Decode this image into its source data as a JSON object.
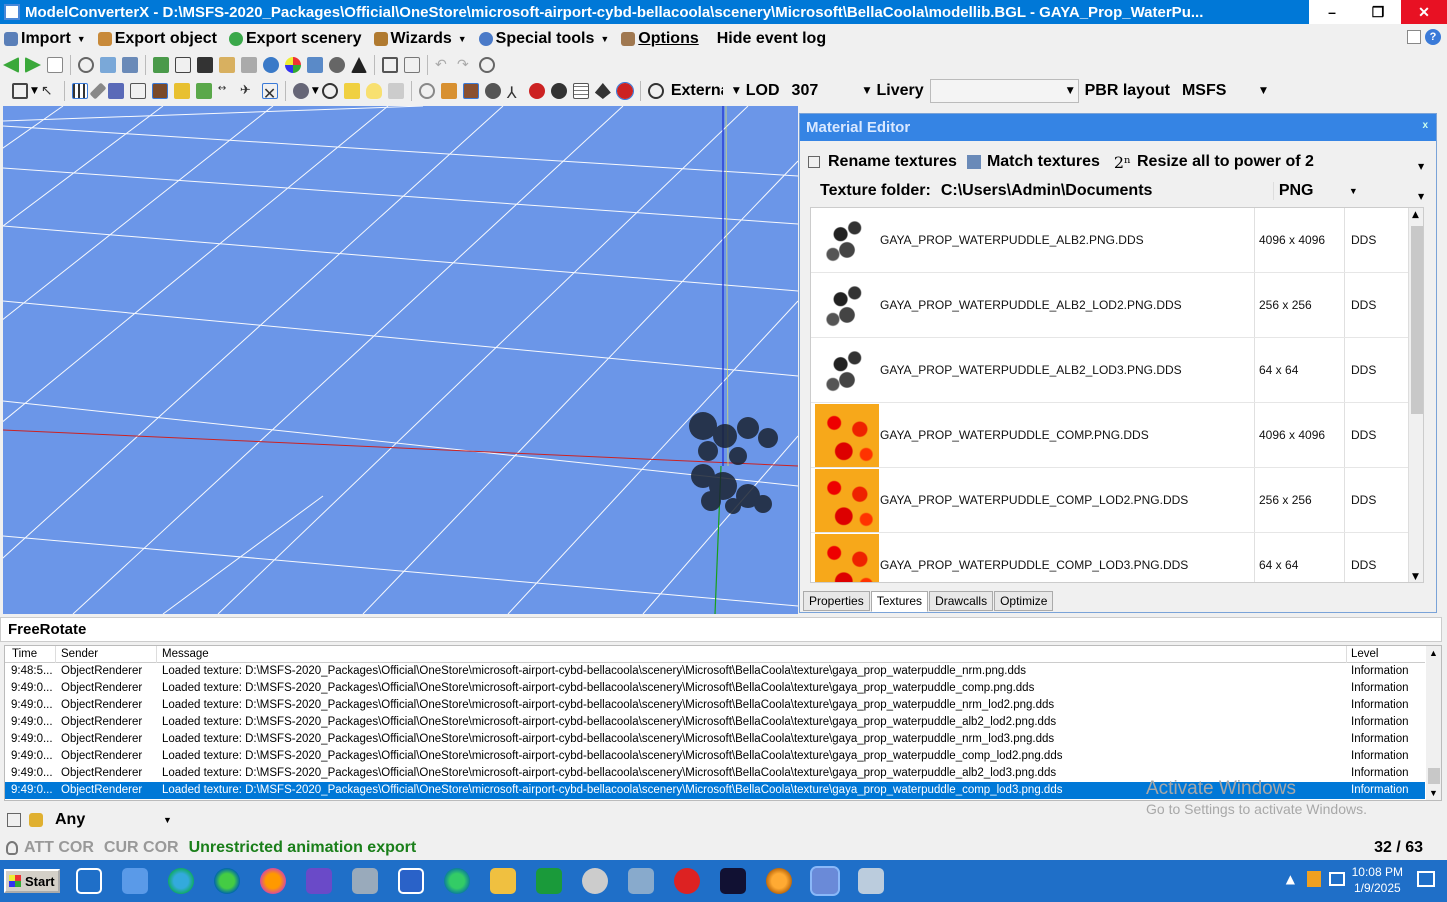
{
  "window": {
    "title": "ModelConverterX - D:\\MSFS-2020_Packages\\Official\\OneStore\\microsoft-airport-cybd-bellacoola\\scenery\\Microsoft\\BellaCoola\\modellib.BGL - GAYA_Prop_WaterPu...",
    "controls": [
      "–",
      "❐",
      "✕"
    ]
  },
  "menu": {
    "import": "Import",
    "export_object": "Export object",
    "export_scenery": "Export scenery",
    "wizards": "Wizards",
    "special_tools": "Special tools",
    "options": "Options",
    "hide_event_log": "Hide event log"
  },
  "toolbar3": {
    "external_label": "Externa",
    "lod_label": "LOD",
    "lod_value": "307",
    "livery_label": "Livery",
    "livery_value": "",
    "pbr_label": "PBR layout",
    "pbr_value": "MSFS"
  },
  "material_editor": {
    "title": "Material Editor",
    "close": "x",
    "rename_textures": "Rename textures",
    "match_textures": "Match textures",
    "resize_prefix": "2ⁿ",
    "resize_all": "Resize all to power of 2",
    "texture_folder_label": "Texture folder:",
    "texture_folder_value": "C:\\Users\\Admin\\Documents",
    "format_value": "PNG",
    "textures": [
      {
        "name": "GAYA_PROP_WATERPUDDLE_ALB2.PNG.DDS",
        "size": "4096 x 4096",
        "format": "DDS",
        "thumb": "mask"
      },
      {
        "name": "GAYA_PROP_WATERPUDDLE_ALB2_LOD2.PNG.DDS",
        "size": "256 x 256",
        "format": "DDS",
        "thumb": "mask"
      },
      {
        "name": "GAYA_PROP_WATERPUDDLE_ALB2_LOD3.PNG.DDS",
        "size": "64 x 64",
        "format": "DDS",
        "thumb": "mask"
      },
      {
        "name": "GAYA_PROP_WATERPUDDLE_COMP.PNG.DDS",
        "size": "4096 x 4096",
        "format": "DDS",
        "thumb": "comp"
      },
      {
        "name": "GAYA_PROP_WATERPUDDLE_COMP_LOD2.PNG.DDS",
        "size": "256 x 256",
        "format": "DDS",
        "thumb": "comp"
      },
      {
        "name": "GAYA_PROP_WATERPUDDLE_COMP_LOD3.PNG.DDS",
        "size": "64 x 64",
        "format": "DDS",
        "thumb": "comp"
      }
    ],
    "tabs": [
      "Properties",
      "Textures",
      "Drawcalls",
      "Optimize"
    ],
    "active_tab": "Textures"
  },
  "mode_label": "FreeRotate",
  "event_log": {
    "columns": [
      "Time",
      "Sender",
      "Message",
      "Level"
    ],
    "rows": [
      {
        "time": "9:48:5...",
        "sender": "ObjectRenderer",
        "message": "Loaded texture: D:\\MSFS-2020_Packages\\Official\\OneStore\\microsoft-airport-cybd-bellacoola\\scenery\\Microsoft\\BellaCoola\\texture\\gaya_prop_waterpuddle_nrm.png.dds",
        "level": "Information"
      },
      {
        "time": "9:49:0...",
        "sender": "ObjectRenderer",
        "message": "Loaded texture: D:\\MSFS-2020_Packages\\Official\\OneStore\\microsoft-airport-cybd-bellacoola\\scenery\\Microsoft\\BellaCoola\\texture\\gaya_prop_waterpuddle_comp.png.dds",
        "level": "Information"
      },
      {
        "time": "9:49:0...",
        "sender": "ObjectRenderer",
        "message": "Loaded texture: D:\\MSFS-2020_Packages\\Official\\OneStore\\microsoft-airport-cybd-bellacoola\\scenery\\Microsoft\\BellaCoola\\texture\\gaya_prop_waterpuddle_nrm_lod2.png.dds",
        "level": "Information"
      },
      {
        "time": "9:49:0...",
        "sender": "ObjectRenderer",
        "message": "Loaded texture: D:\\MSFS-2020_Packages\\Official\\OneStore\\microsoft-airport-cybd-bellacoola\\scenery\\Microsoft\\BellaCoola\\texture\\gaya_prop_waterpuddle_alb2_lod2.png.dds",
        "level": "Information"
      },
      {
        "time": "9:49:0...",
        "sender": "ObjectRenderer",
        "message": "Loaded texture: D:\\MSFS-2020_Packages\\Official\\OneStore\\microsoft-airport-cybd-bellacoola\\scenery\\Microsoft\\BellaCoola\\texture\\gaya_prop_waterpuddle_nrm_lod3.png.dds",
        "level": "Information"
      },
      {
        "time": "9:49:0...",
        "sender": "ObjectRenderer",
        "message": "Loaded texture: D:\\MSFS-2020_Packages\\Official\\OneStore\\microsoft-airport-cybd-bellacoola\\scenery\\Microsoft\\BellaCoola\\texture\\gaya_prop_waterpuddle_comp_lod2.png.dds",
        "level": "Information"
      },
      {
        "time": "9:49:0...",
        "sender": "ObjectRenderer",
        "message": "Loaded texture: D:\\MSFS-2020_Packages\\Official\\OneStore\\microsoft-airport-cybd-bellacoola\\scenery\\Microsoft\\BellaCoola\\texture\\gaya_prop_waterpuddle_alb2_lod3.png.dds",
        "level": "Information"
      },
      {
        "time": "9:49:0...",
        "sender": "ObjectRenderer",
        "message": "Loaded texture: D:\\MSFS-2020_Packages\\Official\\OneStore\\microsoft-airport-cybd-bellacoola\\scenery\\Microsoft\\BellaCoola\\texture\\gaya_prop_waterpuddle_comp_lod3.png.dds",
        "level": "Information",
        "selected": true
      }
    ]
  },
  "watermark": {
    "line1": "Activate Windows",
    "line2": "Go to Settings to activate Windows."
  },
  "filter": {
    "value": "Any"
  },
  "status": {
    "att_cor": "ATT COR",
    "cur_cor": "CUR COR",
    "message": "Unrestricted animation export",
    "counter": "32 / 63"
  },
  "taskbar": {
    "start": "Start",
    "time": "10:08 PM",
    "date": "1/9/2025"
  },
  "colors": {
    "titlebar": "#0078d7",
    "viewport": "#6b96e8",
    "selection": "#0078d7",
    "taskbar": "#1f6fc8",
    "status_green": "#1a7f1a"
  }
}
